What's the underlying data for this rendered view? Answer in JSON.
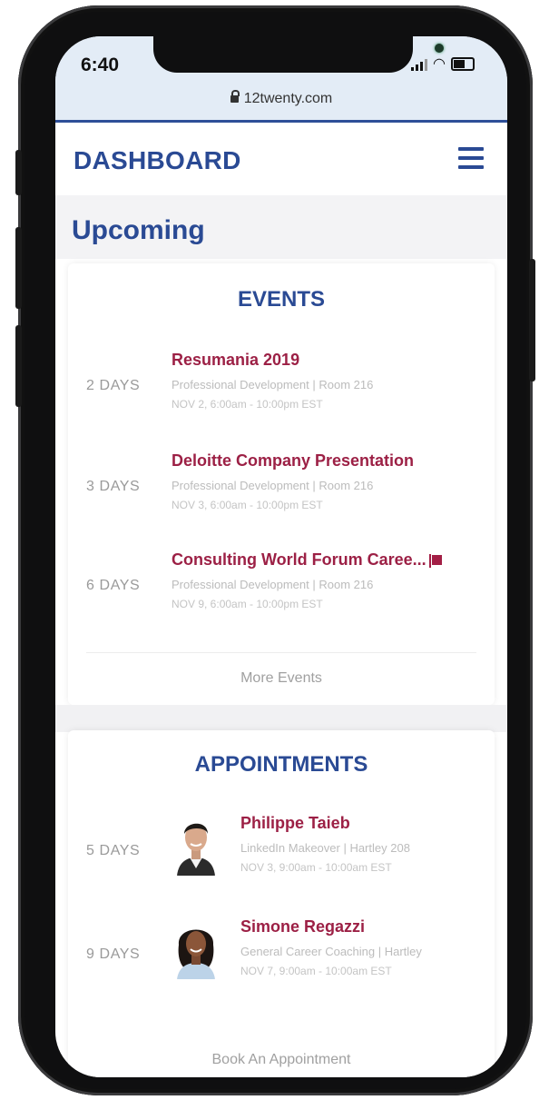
{
  "status_bar": {
    "time": "6:40",
    "url": "12twenty.com"
  },
  "header": {
    "title": "DASHBOARD",
    "menu_icon": "hamburger-icon"
  },
  "section": {
    "title": "Upcoming"
  },
  "events": {
    "title": "EVENTS",
    "items": [
      {
        "days": "2 DAYS",
        "title": "Resumania 2019",
        "subtitle": "Professional Development | Room 216",
        "time": "NOV 2, 6:00am - 10:00pm EST",
        "flagged": false
      },
      {
        "days": "3 DAYS",
        "title": "Deloitte Company Presentation",
        "subtitle": "Professional Development | Room 216",
        "time": "NOV 3, 6:00am - 10:00pm EST",
        "flagged": false
      },
      {
        "days": "6 DAYS",
        "title": "Consulting World Forum Caree...",
        "subtitle": "Professional Development | Room 216",
        "time": "NOV 9, 6:00am - 10:00pm EST",
        "flagged": true
      }
    ],
    "more_label": "More Events"
  },
  "appointments": {
    "title": "APPOINTMENTS",
    "items": [
      {
        "days": "5 DAYS",
        "name": "Philippe Taieb",
        "subtitle": "LinkedIn Makeover | Hartley 208",
        "time": "NOV 3, 9:00am - 10:00am EST"
      },
      {
        "days": "9 DAYS",
        "name": "Simone Regazzi",
        "subtitle": "General Career Coaching | Hartley",
        "time": "NOV 7, 9:00am - 10:00am EST"
      }
    ],
    "book_label": "Book An Appointment"
  },
  "colors": {
    "brand_blue": "#2a4a94",
    "accent_red": "#9c2045",
    "muted": "#a0a0a0"
  }
}
